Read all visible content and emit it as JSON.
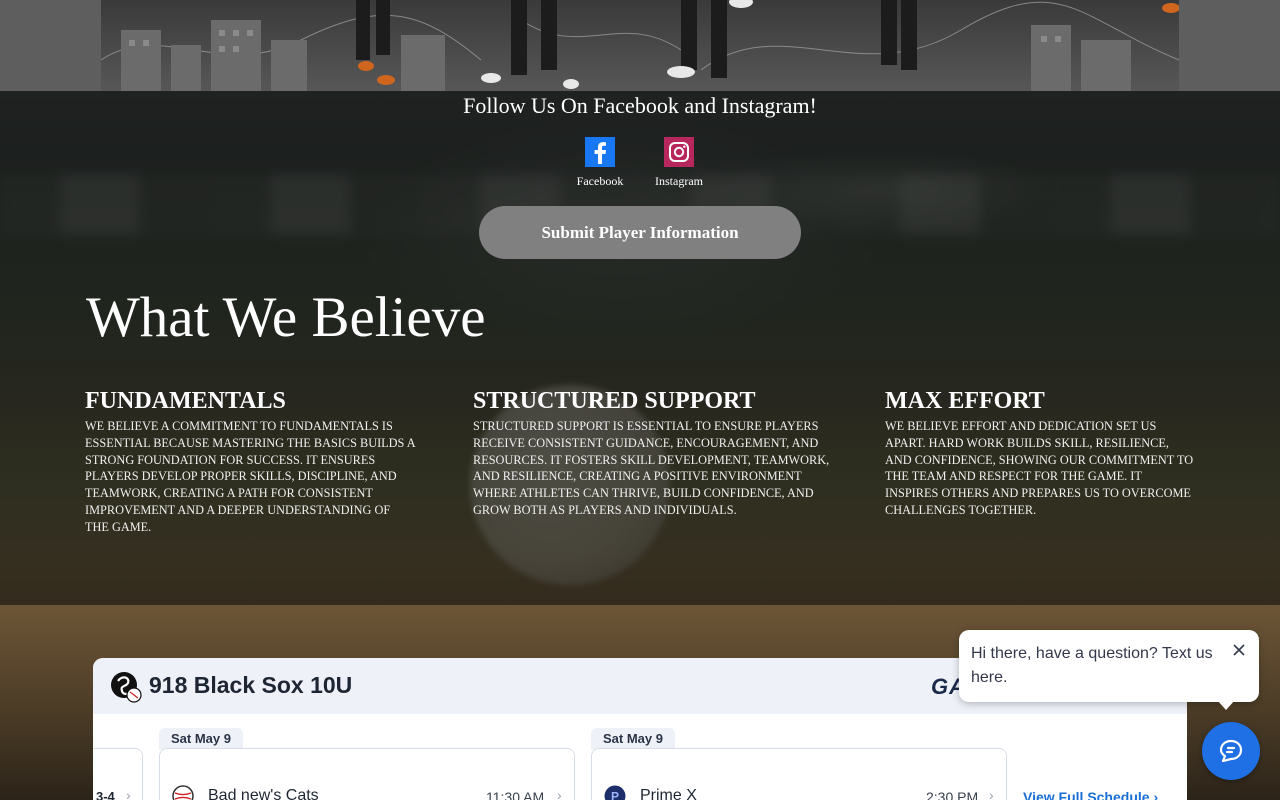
{
  "social": {
    "heading": "Follow Us On Facebook and Instagram!",
    "facebook": {
      "label": "Facebook",
      "icon": "facebook-icon",
      "color": "#1877f2"
    },
    "instagram": {
      "label": "Instagram",
      "icon": "instagram-icon",
      "color": "#c13584"
    }
  },
  "cta": {
    "submit_label": "Submit Player Information"
  },
  "beliefs": {
    "title": "What We Believe",
    "items": [
      {
        "heading": "FUNDAMENTALS",
        "text": "WE BELIEVE A COMMITMENT TO FUNDAMENTALS IS ESSENTIAL BECAUSE MASTERING THE BASICS BUILDS A STRONG FOUNDATION FOR SUCCESS. IT ENSURES PLAYERS DEVELOP PROPER SKILLS, DISCIPLINE, AND TEAMWORK, CREATING A PATH FOR CONSISTENT IMPROVEMENT AND A DEEPER UNDERSTANDING OF THE GAME."
      },
      {
        "heading": "STRUCTURED SUPPORT",
        "text": "STRUCTURED SUPPORT IS ESSENTIAL TO ENSURE PLAYERS RECEIVE CONSISTENT GUIDANCE, ENCOURAGEMENT, AND RESOURCES. IT FOSTERS SKILL DEVELOPMENT, TEAMWORK, AND RESILIENCE, CREATING A POSITIVE ENVIRONMENT WHERE ATHLETES CAN THRIVE, BUILD CONFIDENCE, AND GROW BOTH AS PLAYERS AND INDIVIDUALS."
      },
      {
        "heading": "MAX EFFORT",
        "text": "WE BELIEVE EFFORT AND DEDICATION SET US APART. HARD WORK BUILDS SKILL, RESILIENCE, AND CONFIDENCE, SHOWING OUR COMMITMENT TO THE TEAM AND RESPECT FOR THE GAME. IT INSPIRES OTHERS AND PREPARES US TO OVERCOME CHALLENGES TOGETHER."
      }
    ]
  },
  "schedule": {
    "team_name": "918 Black Sox 10U",
    "brand_partial": "GA",
    "previous_result": "3-4",
    "games": [
      {
        "date": "Sat May 9",
        "opponent": "Bad new's Cats",
        "time": "11:30 AM"
      },
      {
        "date": "Sat May 9",
        "opponent": "Prime X",
        "time": "2:30 PM"
      }
    ],
    "view_full_label": "View Full Schedule"
  },
  "chat": {
    "message": "Hi there, have a question? Text us here.",
    "accent_color": "#1f6fe5"
  }
}
